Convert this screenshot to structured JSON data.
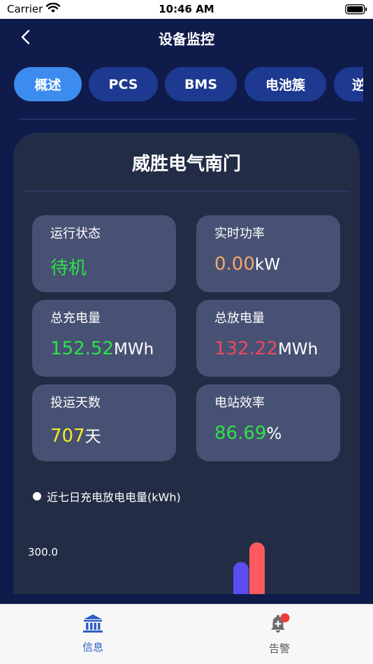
{
  "status_bar": {
    "carrier": "Carrier",
    "time": "10:46 AM"
  },
  "nav": {
    "title": "设备监控"
  },
  "tabs": [
    {
      "label": "概述",
      "active": true
    },
    {
      "label": "PCS",
      "active": false
    },
    {
      "label": "BMS",
      "active": false
    },
    {
      "label": "电池簇",
      "active": false
    },
    {
      "label": "逆",
      "active": false
    }
  ],
  "station": {
    "name": "威胜电气南门",
    "stats": {
      "run_status": {
        "label": "运行状态",
        "value": "待机",
        "unit": ""
      },
      "realtime_power": {
        "label": "实时功率",
        "value": "0.00",
        "unit": "kW"
      },
      "total_charge": {
        "label": "总充电量",
        "value": "152.52",
        "unit": "MWh"
      },
      "total_discharge": {
        "label": "总放电量",
        "value": "132.22",
        "unit": "MWh"
      },
      "days_in_operation": {
        "label": "投运天数",
        "value": "707",
        "unit": "天"
      },
      "station_efficiency": {
        "label": "电站效率",
        "value": "86.69",
        "unit": "%"
      }
    }
  },
  "chart_data": {
    "type": "bar",
    "title": "近七日充电放电电量(kWh)",
    "y_tick_labels": [
      "300.0"
    ],
    "series": [
      {
        "color": "#5b4cf0",
        "values": [
          260
        ]
      },
      {
        "color": "#ff5a5f",
        "values": [
          340
        ]
      }
    ]
  },
  "colors": {
    "green": "#2fe04a",
    "orange": "#f5a56a",
    "red": "#f0485a",
    "yellow": "#f4ea2a",
    "active_tab": "#3c8cf0",
    "tab": "#1e3990"
  },
  "bottom_tabs": [
    {
      "label": "信息",
      "icon": "bank-icon",
      "active": true
    },
    {
      "label": "告警",
      "icon": "bell-alert-icon",
      "active": false
    }
  ]
}
